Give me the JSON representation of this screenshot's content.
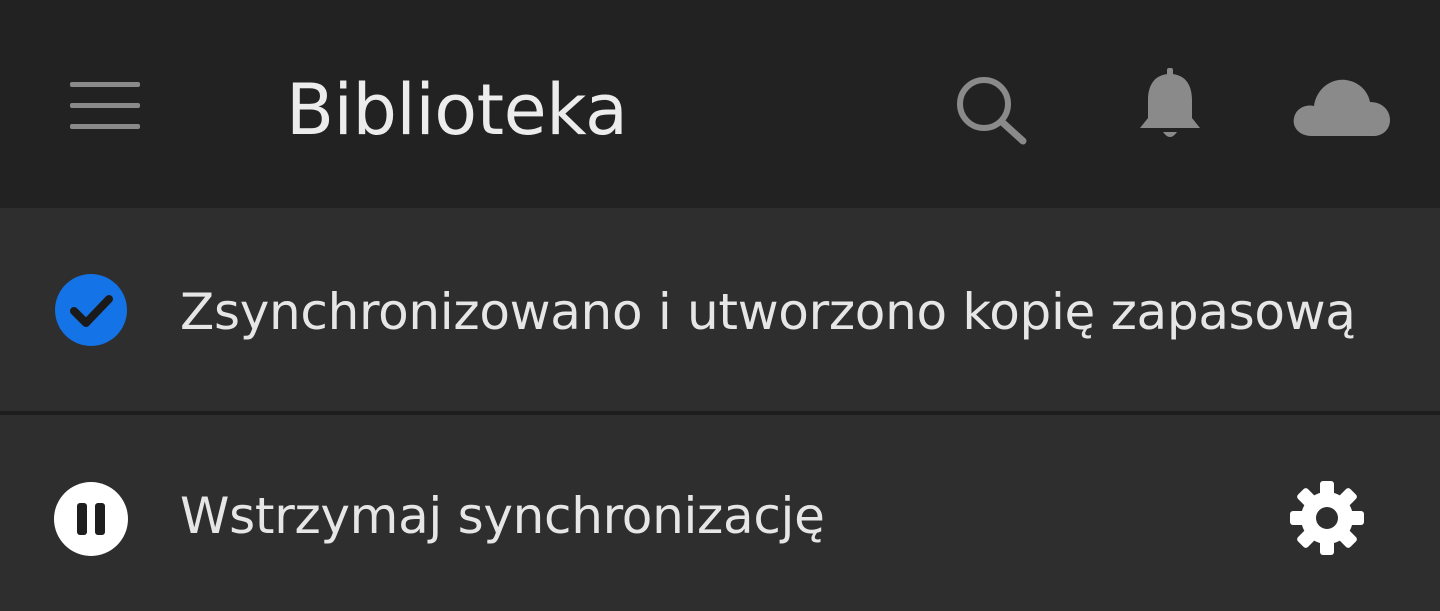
{
  "appbar": {
    "title": "Biblioteka",
    "icons": {
      "menu": "hamburger-menu-icon",
      "search": "search-icon",
      "notifications": "bell-icon",
      "cloud": "cloud-icon"
    }
  },
  "sync_status": {
    "label": "Zsynchronizowano i utworzono kopię zapasową",
    "icon": "check-circle-icon",
    "icon_color": "#1473e6"
  },
  "pause_sync": {
    "label": "Wstrzymaj synchronizację",
    "icon": "pause-circle-icon",
    "settings_icon": "gear-icon"
  },
  "colors": {
    "appbar_bg": "#222222",
    "content_bg": "#2e2e2e",
    "accent": "#1473e6",
    "icon_gray": "#8a8a8a"
  }
}
